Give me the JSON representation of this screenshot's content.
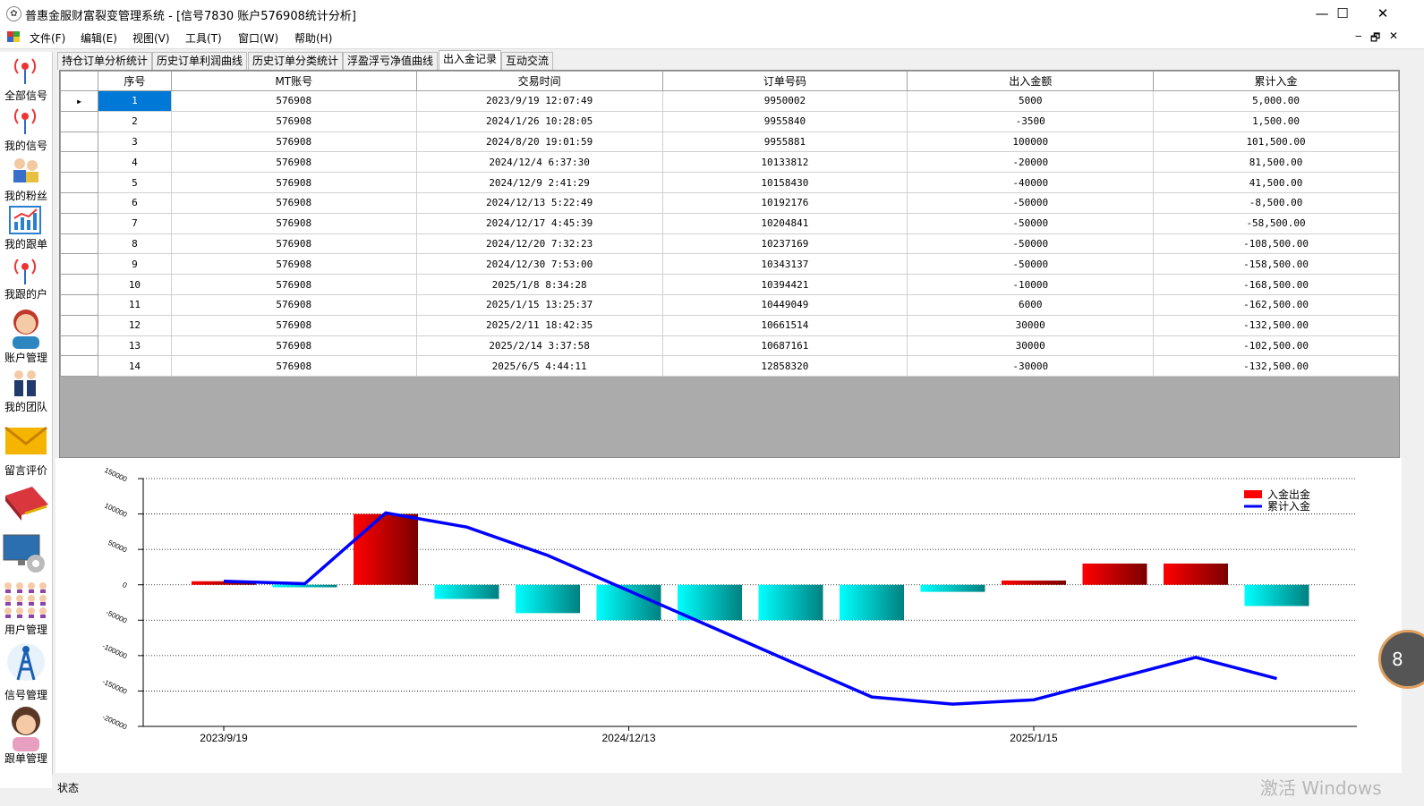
{
  "window": {
    "title": "普惠金服财富裂变管理系统 - [信号7830 账户576908统计分析]",
    "minimize": "—",
    "maximize": "☐",
    "close": "✕"
  },
  "menu": {
    "items": [
      "文件(F)",
      "编辑(E)",
      "视图(V)",
      "工具(T)",
      "窗口(W)",
      "帮助(H)"
    ],
    "mdi": [
      "‒",
      "🗗",
      "✕"
    ]
  },
  "sidebar": {
    "items": [
      {
        "label": "全部信号",
        "icon": "signal-antenna-icon"
      },
      {
        "label": "我的信号",
        "icon": "signal-antenna-icon"
      },
      {
        "label": "我的粉丝",
        "icon": "fans-icon"
      },
      {
        "label": "我的跟单",
        "icon": "chart-icon"
      },
      {
        "label": "我跟的户",
        "icon": "signal-antenna-icon"
      },
      {
        "label": "账户管理",
        "icon": "user-avatar-icon"
      },
      {
        "label": "我的团队",
        "icon": "team-icon"
      },
      {
        "label": "留言评价",
        "icon": "mail-icon"
      },
      {
        "label": "",
        "icon": "book-icon"
      },
      {
        "label": "",
        "icon": "computer-settings-icon"
      },
      {
        "label": "用户管理",
        "icon": "users-grid-icon"
      },
      {
        "label": "信号管理",
        "icon": "tower-icon"
      },
      {
        "label": "跟单管理",
        "icon": "woman-avatar-icon"
      }
    ]
  },
  "tabs": [
    "持仓订单分析统计",
    "历史订单利润曲线",
    "历史订单分类统计",
    "浮盈浮亏净值曲线",
    "出入金记录",
    "互动交流"
  ],
  "active_tab": 4,
  "grid": {
    "columns": [
      "序号",
      "MT账号",
      "交易时间",
      "订单号码",
      "出入金额",
      "累计入金"
    ],
    "rows": [
      [
        "1",
        "576908",
        "2023/9/19 12:07:49",
        "9950002",
        "5000",
        "5,000.00"
      ],
      [
        "2",
        "576908",
        "2024/1/26 10:28:05",
        "9955840",
        "-3500",
        "1,500.00"
      ],
      [
        "3",
        "576908",
        "2024/8/20 19:01:59",
        "9955881",
        "100000",
        "101,500.00"
      ],
      [
        "4",
        "576908",
        "2024/12/4 6:37:30",
        "10133812",
        "-20000",
        "81,500.00"
      ],
      [
        "5",
        "576908",
        "2024/12/9 2:41:29",
        "10158430",
        "-40000",
        "41,500.00"
      ],
      [
        "6",
        "576908",
        "2024/12/13 5:22:49",
        "10192176",
        "-50000",
        "-8,500.00"
      ],
      [
        "7",
        "576908",
        "2024/12/17 4:45:39",
        "10204841",
        "-50000",
        "-58,500.00"
      ],
      [
        "8",
        "576908",
        "2024/12/20 7:32:23",
        "10237169",
        "-50000",
        "-108,500.00"
      ],
      [
        "9",
        "576908",
        "2024/12/30 7:53:00",
        "10343137",
        "-50000",
        "-158,500.00"
      ],
      [
        "10",
        "576908",
        "2025/1/8 8:34:28",
        "10394421",
        "-10000",
        "-168,500.00"
      ],
      [
        "11",
        "576908",
        "2025/1/15 13:25:37",
        "10449049",
        "6000",
        "-162,500.00"
      ],
      [
        "12",
        "576908",
        "2025/2/11 18:42:35",
        "10661514",
        "30000",
        "-132,500.00"
      ],
      [
        "13",
        "576908",
        "2025/2/14 3:37:58",
        "10687161",
        "30000",
        "-102,500.00"
      ],
      [
        "14",
        "576908",
        "2025/6/5 4:44:11",
        "12858320",
        "-30000",
        "-132,500.00"
      ]
    ]
  },
  "chart_data": {
    "type": "bar",
    "categories": [
      "2023/9/19",
      "2024/1/26",
      "2024/8/20",
      "2024/12/4",
      "2024/12/9",
      "2024/12/13",
      "2024/12/17",
      "2024/12/20",
      "2024/12/30",
      "2025/1/8",
      "2025/1/15",
      "2025/2/11",
      "2025/2/14",
      "2025/6/5"
    ],
    "x_tick_labels": [
      {
        "index": 0,
        "label": "2023/9/19"
      },
      {
        "index": 5,
        "label": "2024/12/13"
      },
      {
        "index": 10,
        "label": "2025/1/15"
      }
    ],
    "series": [
      {
        "name": "入金出金",
        "type": "bar",
        "values": [
          5000,
          -3500,
          100000,
          -20000,
          -40000,
          -50000,
          -50000,
          -50000,
          -50000,
          -10000,
          6000,
          30000,
          30000,
          -30000
        ]
      },
      {
        "name": "累计入金",
        "type": "line",
        "values": [
          5000,
          1500,
          101500,
          81500,
          41500,
          -8500,
          -58500,
          -108500,
          -158500,
          -168500,
          -162500,
          -132500,
          -102500,
          -132500
        ]
      }
    ],
    "y_ticks": [
      150000,
      100000,
      50000,
      0,
      -50000,
      -100000,
      -150000,
      -200000
    ],
    "ylim": [
      -200000,
      150000
    ],
    "grid": true,
    "legend_position": "top-right",
    "colors": {
      "positive_bar": "#ff0000",
      "negative_bar": "#00ffff",
      "line": "#0000ff"
    }
  },
  "status": {
    "text": "状态"
  },
  "watermark": "激活 Windows",
  "floating_button": "8"
}
